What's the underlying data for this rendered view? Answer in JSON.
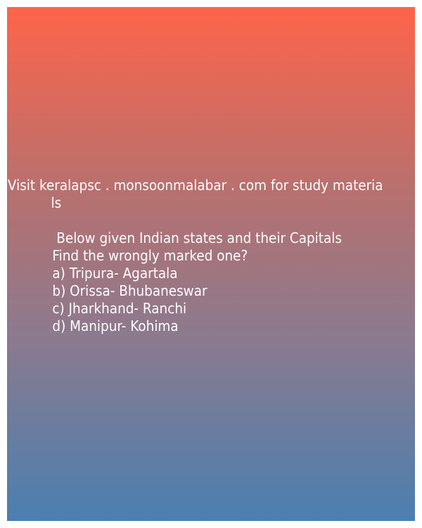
{
  "intro": {
    "line1": "Visit keralapsc . monsoonmalabar . com for study materia",
    "line2": "ls"
  },
  "question": {
    "prompt_line1": " Below given Indian states and their Capitals",
    "prompt_line2": "Find the wrongly marked one?",
    "options": [
      "a) Tripura- Agartala",
      "b) Orissa- Bhubaneswar",
      "c) Jharkhand- Ranchi",
      "d) Manipur- Kohima"
    ]
  }
}
